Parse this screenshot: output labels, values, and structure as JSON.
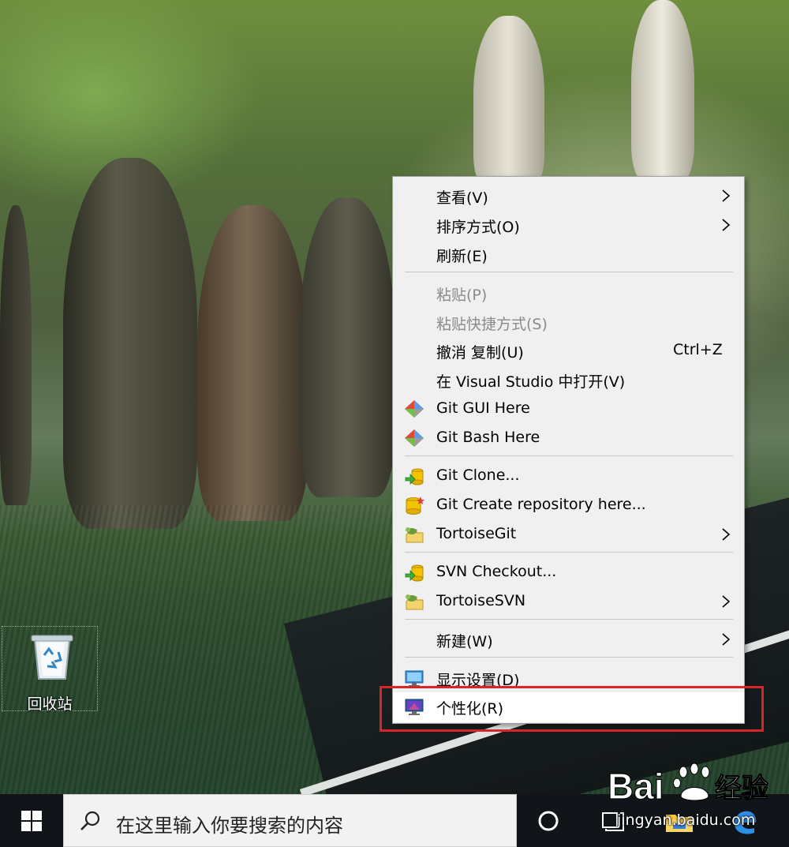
{
  "desktop": {
    "icons": [
      {
        "label": "回收站",
        "icon": "recycle-bin-icon"
      }
    ]
  },
  "context_menu": {
    "items": [
      {
        "label": "查看(V)",
        "submenu": true,
        "disabled": false
      },
      {
        "label": "排序方式(O)",
        "submenu": true,
        "disabled": false
      },
      {
        "label": "刷新(E)",
        "submenu": false,
        "disabled": false
      },
      {
        "label": "粘贴(P)",
        "submenu": false,
        "disabled": true
      },
      {
        "label": "粘贴快捷方式(S)",
        "submenu": false,
        "disabled": true
      },
      {
        "label": "撤消 复制(U)",
        "shortcut": "Ctrl+Z",
        "submenu": false,
        "disabled": false
      },
      {
        "label": "在 Visual Studio 中打开(V)",
        "submenu": false,
        "disabled": false
      },
      {
        "label": "Git GUI Here",
        "icon": "git-gui-icon",
        "submenu": false,
        "disabled": false
      },
      {
        "label": "Git Bash Here",
        "icon": "git-bash-icon",
        "submenu": false,
        "disabled": false
      },
      {
        "label": "Git Clone...",
        "icon": "git-clone-icon",
        "submenu": false,
        "disabled": false
      },
      {
        "label": "Git Create repository here...",
        "icon": "git-create-repo-icon",
        "submenu": false,
        "disabled": false
      },
      {
        "label": "TortoiseGit",
        "icon": "tortoisegit-icon",
        "submenu": true,
        "disabled": false
      },
      {
        "label": "SVN Checkout...",
        "icon": "svn-checkout-icon",
        "submenu": false,
        "disabled": false
      },
      {
        "label": "TortoiseSVN",
        "icon": "tortoisesvn-icon",
        "submenu": true,
        "disabled": false
      },
      {
        "label": "新建(W)",
        "submenu": true,
        "disabled": false
      },
      {
        "label": "显示设置(D)",
        "icon": "display-settings-icon",
        "submenu": false,
        "disabled": false
      },
      {
        "label": "个性化(R)",
        "icon": "personalize-icon",
        "submenu": false,
        "disabled": false,
        "highlighted": true
      }
    ]
  },
  "taskbar": {
    "search_placeholder": "在这里输入你要搜索的内容",
    "buttons": [
      "windows-start-icon",
      "cortana-icon",
      "task-view-icon",
      "file-explorer-icon",
      "edge-icon"
    ]
  },
  "watermark": {
    "logo_text": "Bai",
    "logo_suffix": "经验",
    "url": "jingyan.baidu.com"
  },
  "colors": {
    "menu_background": "#f0f0f0",
    "highlight_border": "#d9252a",
    "taskbar": "#11151a"
  }
}
